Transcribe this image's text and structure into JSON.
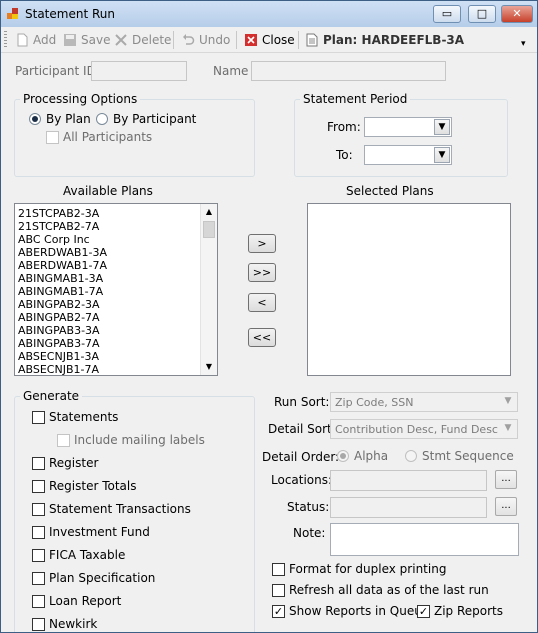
{
  "window": {
    "title": "Statement Run",
    "controls": {
      "minimize": "▭",
      "maximize": "□",
      "close": "✕"
    }
  },
  "toolbar": {
    "add": "Add",
    "save": "Save",
    "delete": "Delete",
    "undo": "Undo",
    "close": "Close",
    "plan": "Plan: HARDEEFLB-3A",
    "overflow": "▾"
  },
  "participant": {
    "id_label": "Participant ID",
    "id_value": "",
    "name_label": "Name",
    "name_value": ""
  },
  "processing_options": {
    "title": "Processing Options",
    "by_plan": "By Plan",
    "by_participant": "By Participant",
    "all_participants": "All Participants"
  },
  "statement_period": {
    "title": "Statement Period",
    "from_label": "From:",
    "to_label": "To:",
    "from_value": "",
    "to_value": ""
  },
  "available_plans": {
    "label": "Available Plans",
    "items": [
      "21STCPAB2-3A",
      "21STCPAB2-7A",
      "ABC Corp Inc",
      "ABERDWAB1-3A",
      "ABERDWAB1-7A",
      "ABINGMAB1-3A",
      "ABINGMAB1-7A",
      "ABINGPAB2-3A",
      "ABINGPAB2-7A",
      "ABINGPAB3-3A",
      "ABINGPAB3-7A",
      "ABSECNJB1-3A",
      "ABSECNJB1-7A"
    ]
  },
  "selected_plans": {
    "label": "Selected Plans",
    "items": []
  },
  "transfer_buttons": {
    "add": ">",
    "add_all": ">>",
    "remove": "<",
    "remove_all": "<<"
  },
  "generate": {
    "title": "Generate",
    "statements": "Statements",
    "include_mailing_labels": "Include mailing labels",
    "items": [
      "Register",
      "Register Totals",
      "Statement Transactions",
      "Investment Fund",
      "FICA Taxable",
      "Plan Specification",
      "Loan Report",
      "Newkirk"
    ]
  },
  "options": {
    "run_sort_label": "Run Sort:",
    "run_sort_value": "Zip Code, SSN",
    "detail_sort_label": "Detail Sort:",
    "detail_sort_value": "Contribution Desc, Fund Desc",
    "detail_order_label": "Detail Order:",
    "alpha": "Alpha",
    "stmt_sequence": "Stmt Sequence",
    "locations_label": "Locations:",
    "status_label": "Status:",
    "note_label": "Note:",
    "ellipsis": "...",
    "duplex": "Format for duplex printing",
    "refresh": "Refresh all data as of the last run",
    "show_reports": "Show Reports in Queue",
    "zip_reports": "Zip Reports",
    "check_mark": "✓"
  },
  "colors": {
    "titlebar": "#b6cde9",
    "close_red": "#c6402a",
    "window_bg": "#f0f0f0"
  }
}
